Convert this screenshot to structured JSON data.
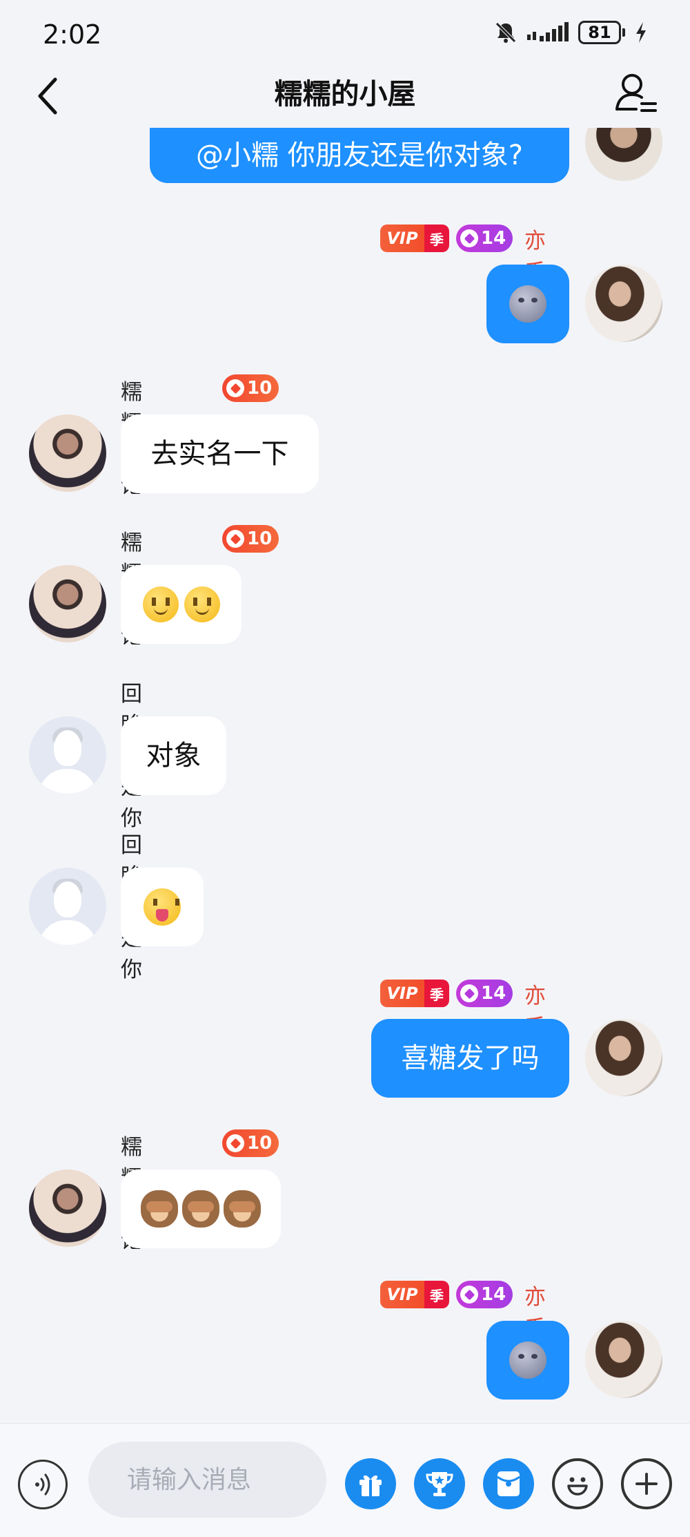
{
  "status": {
    "time": "2:02",
    "battery": "81"
  },
  "header": {
    "title": "糯糯的小屋"
  },
  "users": {
    "self": {
      "name": "亦禾",
      "vip": "VIP",
      "season": "季",
      "level": "14"
    },
    "nuonuo": {
      "name": "糯糯饱饱",
      "level": "10"
    },
    "huimou": {
      "name": "回眸皆是你"
    }
  },
  "messages": [
    {
      "text": "@小糯 你朋友还是你对象?"
    },
    {
      "emoji": "new-moon-face"
    },
    {
      "text": "去实名一下"
    },
    {
      "emoji": "slightly-smiling-face x2"
    },
    {
      "text": "对象"
    },
    {
      "emoji": "face-with-tongue"
    },
    {
      "text": "喜糖发了吗"
    },
    {
      "emoji": "see-no-evil-monkey x3"
    },
    {
      "emoji": "new-moon-face"
    }
  ],
  "input": {
    "placeholder": "请输入消息"
  },
  "colors": {
    "accent": "#1e90ff",
    "self_name": "#e14b3a",
    "level_red": "#f2472f",
    "level_purple": "#b43ade"
  },
  "icons": [
    "back-icon",
    "group-members-icon",
    "voice-icon",
    "gift-icon",
    "trophy-icon",
    "red-packet-icon",
    "emoji-icon",
    "plus-icon"
  ]
}
